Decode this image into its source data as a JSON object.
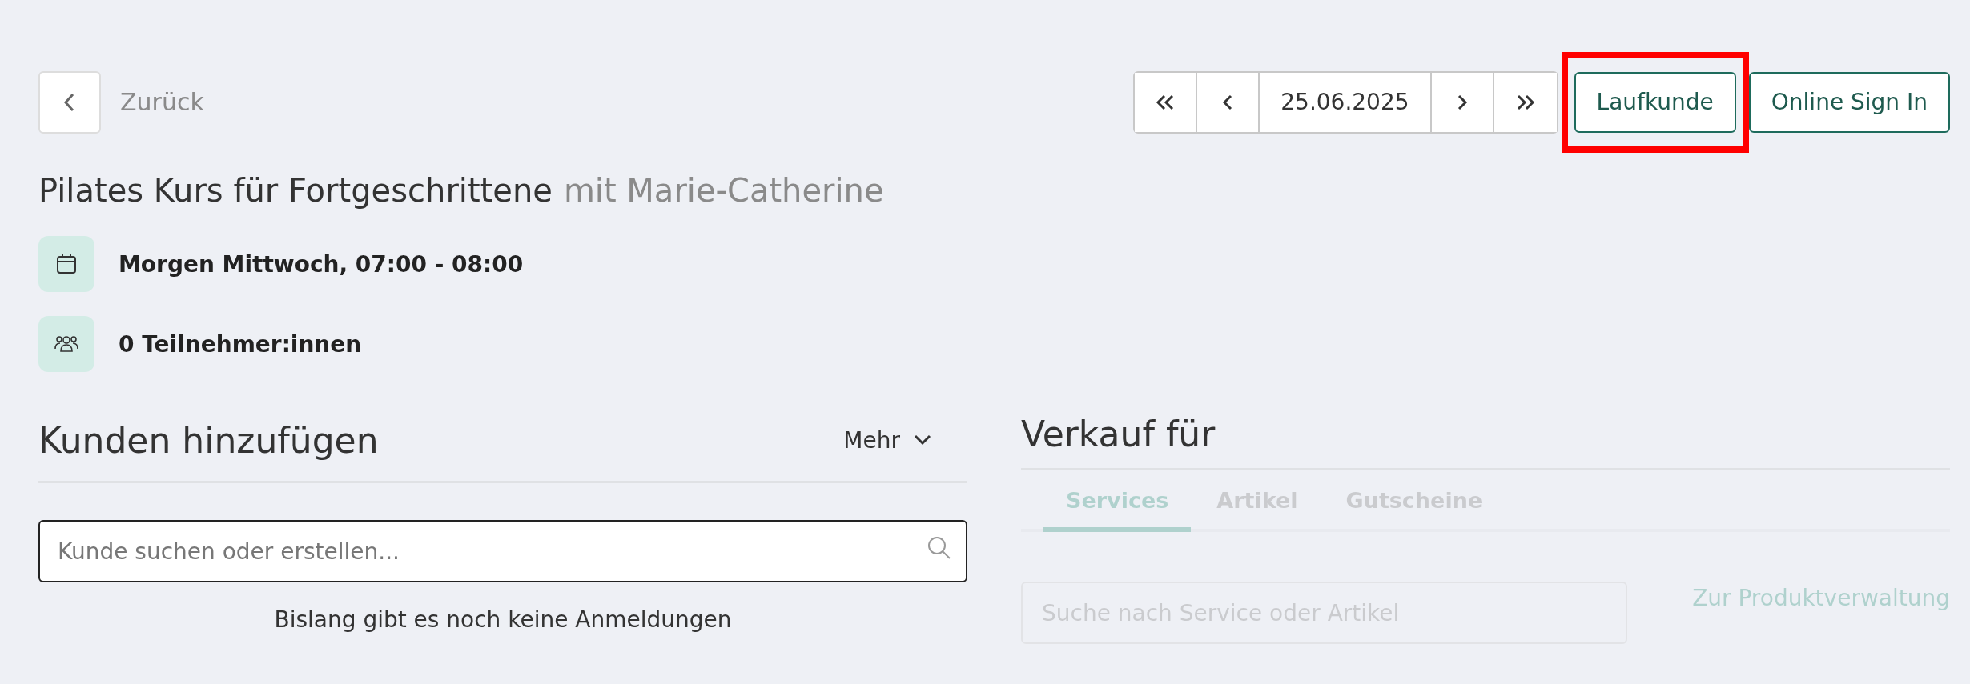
{
  "back": {
    "label": "Zurück"
  },
  "date_nav": {
    "date": "25.06.2025"
  },
  "actions": [
    {
      "label": "Laufkunde",
      "highlighted": true
    },
    {
      "label": "Online Sign In",
      "highlighted": false
    }
  ],
  "course": {
    "title": "Pilates Kurs für Fortgeschrittene",
    "instructor": "mit Marie-Catherine"
  },
  "info": [
    {
      "kind": "date",
      "text": "Morgen Mittwoch, 07:00 - 08:00"
    },
    {
      "kind": "participants",
      "text": "0 Teilnehmer:innen"
    }
  ],
  "customers": {
    "title": "Kunden hinzufügen",
    "more": "Mehr",
    "search": {
      "placeholder": "Kunde suchen oder erstellen..."
    },
    "empty": "Bislang gibt es noch keine Anmeldungen"
  },
  "sale": {
    "title": "Verkauf für",
    "disabled": true,
    "tabs": [
      {
        "label": "Services",
        "selected": true
      },
      {
        "label": "Artikel",
        "selected": false
      },
      {
        "label": "Gutscheine",
        "selected": false
      }
    ],
    "search": {
      "placeholder": "Suche nach Service oder Artikel"
    },
    "link": "Zur Produktverwaltung"
  }
}
